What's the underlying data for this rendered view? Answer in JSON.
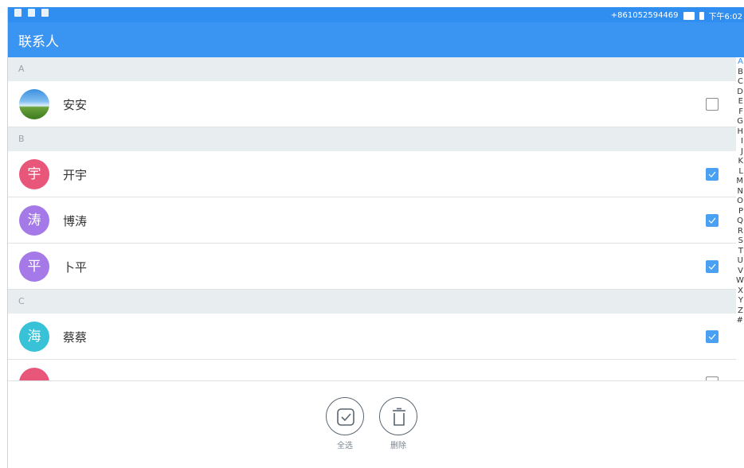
{
  "status_bar": {
    "phone_number": "+861052594469",
    "time": "下午6:02"
  },
  "app_bar": {
    "title": "联系人"
  },
  "sections": [
    {
      "letter": "A",
      "contacts": [
        {
          "name": "安安",
          "avatar_char": "",
          "avatar_type": "photo",
          "checked": false
        }
      ]
    },
    {
      "letter": "B",
      "contacts": [
        {
          "name": "开宇",
          "avatar_char": "宇",
          "avatar_color": "#e8567a",
          "checked": true
        },
        {
          "name": "博涛",
          "avatar_char": "涛",
          "avatar_color": "#a57ae8",
          "checked": true
        },
        {
          "name": "卜平",
          "avatar_char": "平",
          "avatar_color": "#a57ae8",
          "checked": true
        }
      ]
    },
    {
      "letter": "C",
      "contacts": [
        {
          "name": "蔡蔡",
          "avatar_char": "海",
          "avatar_color": "#38c2d8",
          "checked": true
        },
        {
          "name": "",
          "avatar_char": "",
          "avatar_color": "#e8567a",
          "checked": false
        }
      ]
    }
  ],
  "index_letters": [
    "A",
    "B",
    "C",
    "D",
    "E",
    "F",
    "G",
    "H",
    "I",
    "J",
    "K",
    "L",
    "M",
    "N",
    "O",
    "P",
    "Q",
    "R",
    "S",
    "T",
    "U",
    "V",
    "W",
    "X",
    "Y",
    "Z",
    "#"
  ],
  "actions": {
    "select_all_label": "全选",
    "delete_label": "删除"
  },
  "colors": {
    "accent": "#3a94f2",
    "checkbox_checked": "#4aa0f2"
  }
}
